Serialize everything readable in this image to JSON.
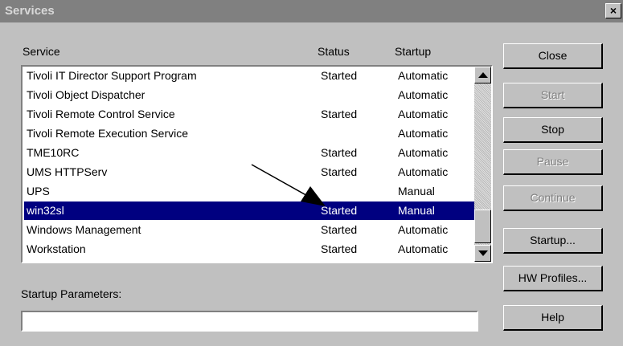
{
  "window": {
    "title": "Services",
    "close_glyph": "×"
  },
  "columns": {
    "service": "Service",
    "status": "Status",
    "startup": "Startup"
  },
  "services": [
    {
      "name": "Tivoli IT Director Support Program",
      "status": "Started",
      "startup": "Automatic"
    },
    {
      "name": "Tivoli Object Dispatcher",
      "status": "",
      "startup": "Automatic"
    },
    {
      "name": "Tivoli Remote Control Service",
      "status": "Started",
      "startup": "Automatic"
    },
    {
      "name": "Tivoli Remote Execution Service",
      "status": "",
      "startup": "Automatic"
    },
    {
      "name": "TME10RC",
      "status": "Started",
      "startup": "Automatic"
    },
    {
      "name": "UMS HTTPServ",
      "status": "Started",
      "startup": "Automatic"
    },
    {
      "name": "UPS",
      "status": "",
      "startup": "Manual"
    },
    {
      "name": "win32sl",
      "status": "Started",
      "startup": "Manual",
      "selected": true
    },
    {
      "name": "Windows Management",
      "status": "Started",
      "startup": "Automatic"
    },
    {
      "name": "Workstation",
      "status": "Started",
      "startup": "Automatic"
    }
  ],
  "buttons": {
    "close": "Close",
    "start": "Start",
    "stop": "Stop",
    "pause": "Pause",
    "continue": "Continue",
    "startup": "Startup...",
    "hw_profiles": "HW Profiles...",
    "help": "Help"
  },
  "startup_parameters": {
    "label": "Startup Parameters:",
    "value": ""
  },
  "colors": {
    "selection": "#000080",
    "face": "#c0c0c0",
    "title_inactive": "#808080"
  }
}
